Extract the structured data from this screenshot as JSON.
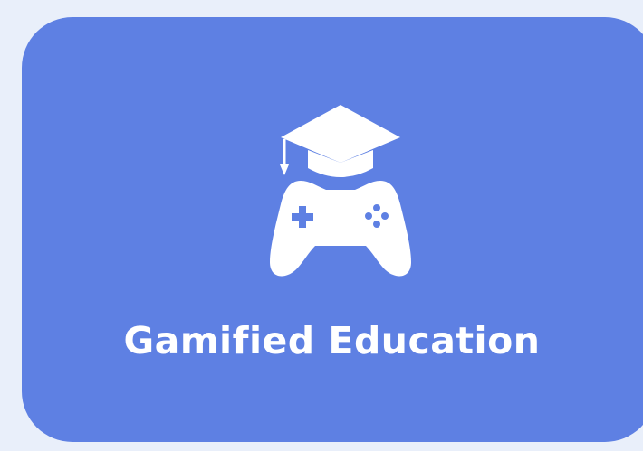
{
  "card": {
    "title": "Gamified Education",
    "icon": "graduation-cap-gamepad-icon",
    "background_color": "#5e80e3",
    "text_color": "#ffffff"
  },
  "page": {
    "background_color": "#e9effa"
  }
}
